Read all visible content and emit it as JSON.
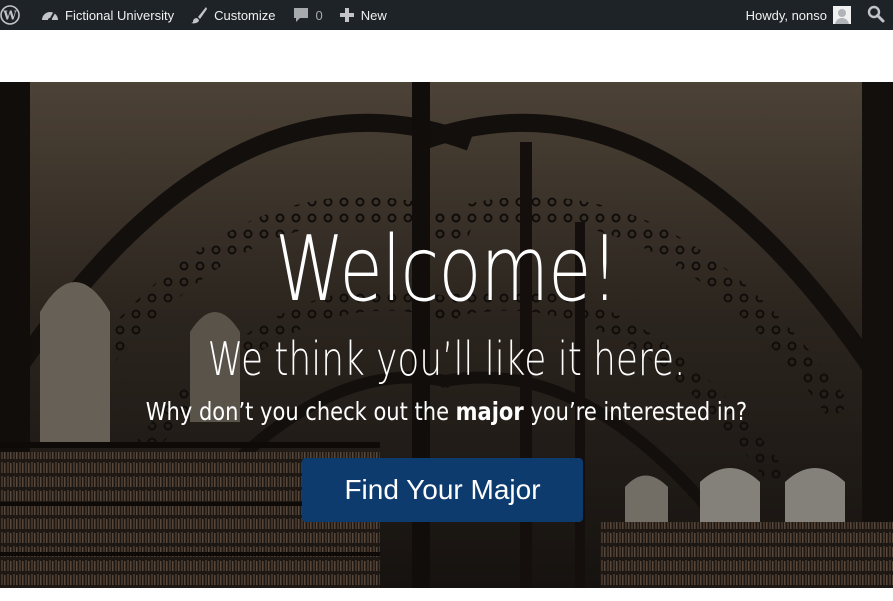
{
  "admin_bar": {
    "wp_logo_icon": "wordpress-logo-icon",
    "site_name": "Fictional University",
    "customize_label": "Customize",
    "comments_count": "0",
    "new_label": "New",
    "howdy_text": "Howdy, nonso",
    "background_color": "#1d2327"
  },
  "hero": {
    "title": "Welcome!",
    "subtitle": "We think you’ll like it here.",
    "line_prefix": "Why don’t you check out the ",
    "line_bold": "major",
    "line_suffix": " you’re interested in?",
    "button_label": "Find Your Major",
    "button_color": "#0d3b6e"
  }
}
